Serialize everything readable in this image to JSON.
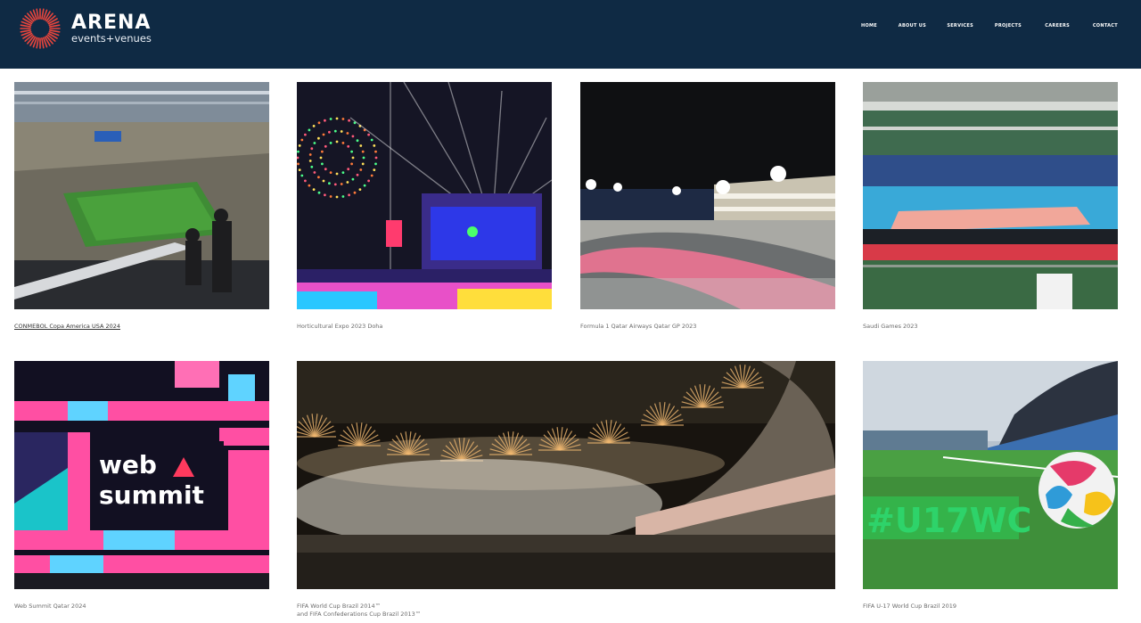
{
  "brand": {
    "name": "ARENA",
    "tagline": "events+venues",
    "colors": {
      "header_bg": "#0f2a44",
      "logo_accent": "#e8453c"
    }
  },
  "nav": {
    "items": [
      {
        "label": "HOME"
      },
      {
        "label": "ABOUT US"
      },
      {
        "label": "SERVICES"
      },
      {
        "label": "PROJECTS"
      },
      {
        "label": "CAREERS"
      },
      {
        "label": "CONTACT"
      }
    ]
  },
  "projects": [
    {
      "caption": "CONMEBOL Copa America USA 2024",
      "image": "stadium-crowd-photo"
    },
    {
      "caption": "Horticultural Expo 2023 Doha",
      "image": "concert-drone-show-photo"
    },
    {
      "caption": "Formula 1 Qatar Airways Qatar GP 2023",
      "image": "race-circuit-night-photo"
    },
    {
      "caption": "Saudi Games 2023",
      "image": "indoor-volleyball-arena-photo"
    },
    {
      "caption": "Web Summit Qatar 2024",
      "image": "web-summit-stage-photo",
      "overlay_text_line1": "web",
      "overlay_text_line2": "summit"
    },
    {
      "caption_line1": "FIFA World Cup Brazil 2014™",
      "caption_line2": "and FIFA Confederations Cup Brazil 2013™",
      "image": "stadium-fireworks-photo"
    },
    {
      "caption": "FIFA U-17 World Cup Brazil 2019",
      "image": "football-pitch-ball-photo",
      "overlay_text": "#U17WC"
    }
  ]
}
